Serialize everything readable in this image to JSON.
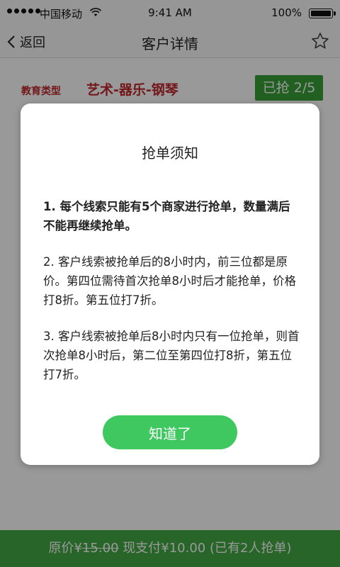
{
  "status_bar": {
    "carrier": "中国移动",
    "time": "9:41 AM",
    "battery": "100%"
  },
  "nav": {
    "back_label": "返回",
    "title": "客户详情"
  },
  "content": {
    "education_label": "教育类型",
    "education_value": "艺术-器乐-钢琴",
    "grab_status": "已抢 2/5"
  },
  "bottom_bar": {
    "original_label": "原价¥",
    "original_price": "15.00",
    "pay_text": " 现支付¥10.00 (已有2人抢单)"
  },
  "modal": {
    "title": "抢单须知",
    "items": [
      "1. 每个线索只能有5个商家进行抢单，数量满后不能再继续抢单。",
      "2.  客户线索被抢单后的8小时内，前三位都是原价。第四位需待首次抢单8小时后才能抢单，价格打8折。第五位打7折。",
      "3.  客户线索被抢单后8小时内只有一位抢单，则首次抢单8小时后，第二位至第四位打8折，第五位打7折。"
    ],
    "ok_label": "知道了"
  },
  "colors": {
    "accent_red": "#c0282d",
    "grab_green": "#3aa13a",
    "button_green": "#3fc760",
    "bottom_green": "#44a844"
  }
}
